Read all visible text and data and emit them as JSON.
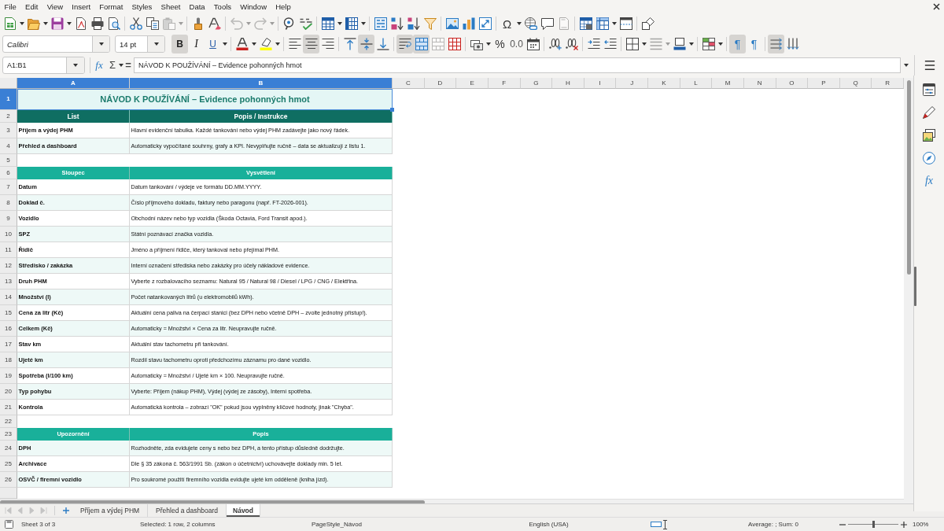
{
  "menu_bar": {
    "items": [
      "File",
      "Edit",
      "View",
      "Insert",
      "Format",
      "Styles",
      "Sheet",
      "Data",
      "Tools",
      "Window",
      "Help"
    ]
  },
  "standard_toolbar": {
    "paste_disabled": true,
    "undo_disabled": true,
    "redo_disabled": true,
    "special_character": "Ω",
    "header_footer_disabled": true
  },
  "formatting_toolbar": {
    "font_name": "Calibri",
    "font_size": "14 pt",
    "bold": {
      "label": "B",
      "on": true
    },
    "italic": {
      "label": "I",
      "on": false
    },
    "underline": {
      "label": "U",
      "on": false
    },
    "align_left": false,
    "align_center": true,
    "align_right": false,
    "align_top": false,
    "align_middle": true,
    "align_bottom": false,
    "wrap_text": true,
    "merge_and_center": true,
    "merge_cells_disabled": true,
    "percent": "%",
    "number_format": "0.0",
    "border_style_disabled": true,
    "left_to_right": {
      "label": "¶",
      "on": true
    },
    "right_to_left": {
      "label": "¶",
      "on": false
    },
    "text_horizontal": true,
    "text_vertical": false
  },
  "formula_bar": {
    "name_box": "A1:B1",
    "function_wizard": "fx",
    "sum": "Σ",
    "formula": "=",
    "content": "NÁVOD K POUŽÍVÁNÍ – Evidence pohonných hmot"
  },
  "sheet": {
    "columns": [
      {
        "label": "A",
        "selected": true
      },
      {
        "label": "B",
        "selected": true
      },
      {
        "label": "C",
        "selected": false
      },
      {
        "label": "D",
        "selected": false
      },
      {
        "label": "E",
        "selected": false
      },
      {
        "label": "F",
        "selected": false
      },
      {
        "label": "G",
        "selected": false
      },
      {
        "label": "H",
        "selected": false
      },
      {
        "label": "I",
        "selected": false
      },
      {
        "label": "J",
        "selected": false
      },
      {
        "label": "K",
        "selected": false
      },
      {
        "label": "L",
        "selected": false
      },
      {
        "label": "M",
        "selected": false
      },
      {
        "label": "N",
        "selected": false
      },
      {
        "label": "O",
        "selected": false
      },
      {
        "label": "P",
        "selected": false
      },
      {
        "label": "Q",
        "selected": false
      },
      {
        "label": "R",
        "selected": false
      }
    ],
    "rows": [
      {
        "number": "1",
        "selected": true,
        "kind": "title",
        "cells": [
          "NÁVOD K POUŽÍVÁNÍ – Evidence pohonných hmot"
        ]
      },
      {
        "number": "2",
        "selected": false,
        "kind": "header",
        "cells": [
          "List",
          "Popis / Instrukce"
        ]
      },
      {
        "number": "3",
        "selected": false,
        "kind": "data",
        "shaded": false,
        "cells": [
          "Příjem a výdej PHM",
          "Hlavní evidenční tabulka. Každé tankování nebo výdej PHM zadávejte jako nový řádek."
        ]
      },
      {
        "number": "4",
        "selected": false,
        "kind": "data",
        "shaded": true,
        "cells": [
          "Přehled a dashboard",
          "Automaticky vypočítané souhrny, grafy a KPI. Nevyplňujte ručně – data se aktualizují z listu 1."
        ]
      },
      {
        "number": "5",
        "selected": false,
        "kind": "empty"
      },
      {
        "number": "6",
        "selected": false,
        "kind": "subheader",
        "cells": [
          "Sloupec",
          "Vysvětlení"
        ]
      },
      {
        "number": "7",
        "selected": false,
        "kind": "data",
        "shaded": false,
        "cells": [
          "Datum",
          "Datum tankování / výdeje ve formátu DD.MM.YYYY."
        ]
      },
      {
        "number": "8",
        "selected": false,
        "kind": "data",
        "shaded": true,
        "cells": [
          "Doklad č.",
          "Číslo příjmového dokladu, faktury nebo paragonu (např. FT-2026-001)."
        ]
      },
      {
        "number": "9",
        "selected": false,
        "kind": "data",
        "shaded": false,
        "cells": [
          "Vozidlo",
          "Obchodní název nebo typ vozidla (Škoda Octavia, Ford Transit apod.)."
        ]
      },
      {
        "number": "10",
        "selected": false,
        "kind": "data",
        "shaded": true,
        "cells": [
          "SPZ",
          "Státní poznávací značka vozidla."
        ]
      },
      {
        "number": "11",
        "selected": false,
        "kind": "data",
        "shaded": false,
        "cells": [
          "Řidič",
          "Jméno a příjmení řidiče, který tankoval nebo přejímal PHM."
        ]
      },
      {
        "number": "12",
        "selected": false,
        "kind": "data",
        "shaded": true,
        "cells": [
          "Středisko / zakázka",
          "Interní označení střediska nebo zakázky pro účely nákladové evidence."
        ]
      },
      {
        "number": "13",
        "selected": false,
        "kind": "data",
        "shaded": false,
        "cells": [
          "Druh PHM",
          "Vyberte z rozbalovacího seznamu: Natural 95 / Natural 98 / Diesel / LPG / CNG / Elektřina."
        ]
      },
      {
        "number": "14",
        "selected": false,
        "kind": "data",
        "shaded": true,
        "cells": [
          "Množství (l)",
          "Počet natankovaných litrů (u elektromobilů kWh)."
        ]
      },
      {
        "number": "15",
        "selected": false,
        "kind": "data",
        "shaded": false,
        "cells": [
          "Cena za litr (Kč)",
          "Aktuální cena paliva na čerpací stanici (bez DPH nebo včetně DPH – zvolte jednotný přístup!)."
        ]
      },
      {
        "number": "16",
        "selected": false,
        "kind": "data",
        "shaded": true,
        "cells": [
          "Celkem (Kč)",
          "Automaticky = Množství × Cena za litr. Neupravujte ručně."
        ]
      },
      {
        "number": "17",
        "selected": false,
        "kind": "data",
        "shaded": false,
        "cells": [
          "Stav km",
          "Aktuální stav tachometru při tankování."
        ]
      },
      {
        "number": "18",
        "selected": false,
        "kind": "data",
        "shaded": true,
        "cells": [
          "Ujeté km",
          "Rozdíl stavu tachometru oproti předchozímu záznamu pro dané vozidlo."
        ]
      },
      {
        "number": "19",
        "selected": false,
        "kind": "data",
        "shaded": false,
        "cells": [
          "Spotřeba (l/100 km)",
          "Automaticky = Množství / Ujeté km × 100. Neupravujte ručně."
        ]
      },
      {
        "number": "20",
        "selected": false,
        "kind": "data",
        "shaded": true,
        "cells": [
          "Typ pohybu",
          "Vyberte: Příjem (nákup PHM), Výdej (výdej ze zásoby), Interní spotřeba."
        ]
      },
      {
        "number": "21",
        "selected": false,
        "kind": "data",
        "shaded": false,
        "cells": [
          "Kontrola",
          "Automatická kontrola – zobrazí \"OK\" pokud jsou vyplněny klíčové hodnoty, jinak \"Chyba\"."
        ]
      },
      {
        "number": "22",
        "selected": false,
        "kind": "empty"
      },
      {
        "number": "23",
        "selected": false,
        "kind": "subheader",
        "cells": [
          "Upozornění",
          "Popis"
        ]
      },
      {
        "number": "24",
        "selected": false,
        "kind": "data",
        "shaded": true,
        "cells": [
          "DPH",
          "Rozhodněte, zda evidujete ceny s nebo bez DPH, a tento přístup důsledně dodržujte."
        ]
      },
      {
        "number": "25",
        "selected": false,
        "kind": "data",
        "shaded": false,
        "cells": [
          "Archivace",
          "Dle § 35 zákona č. 563/1991 Sb. (zákon o účetnictví) uchovávejte doklady min. 5 let."
        ]
      },
      {
        "number": "26",
        "selected": false,
        "kind": "data",
        "shaded": true,
        "cells": [
          "OSVČ / firemní vozidlo",
          "Pro soukromé použití firemního vozidla evidujte ujeté km odděleně (kniha jízd)."
        ]
      }
    ]
  },
  "sidebar": {
    "functions": "fx"
  },
  "sheet_tabs": [
    {
      "label": "Příjem a výdej PHM",
      "selected": false
    },
    {
      "label": "Přehled a dashboard",
      "selected": false
    },
    {
      "label": "Návod",
      "selected": true
    }
  ],
  "status_bar": {
    "sheet": "Sheet 3 of 3",
    "selection": "Selected: 1 row, 2 columns",
    "page_style": "PageStyle_Návod",
    "language": "English (USA)",
    "summary": "Average: ; Sum: 0",
    "zoom_slider": {
      "level": 0.5
    },
    "zoom_percent": "100%"
  }
}
